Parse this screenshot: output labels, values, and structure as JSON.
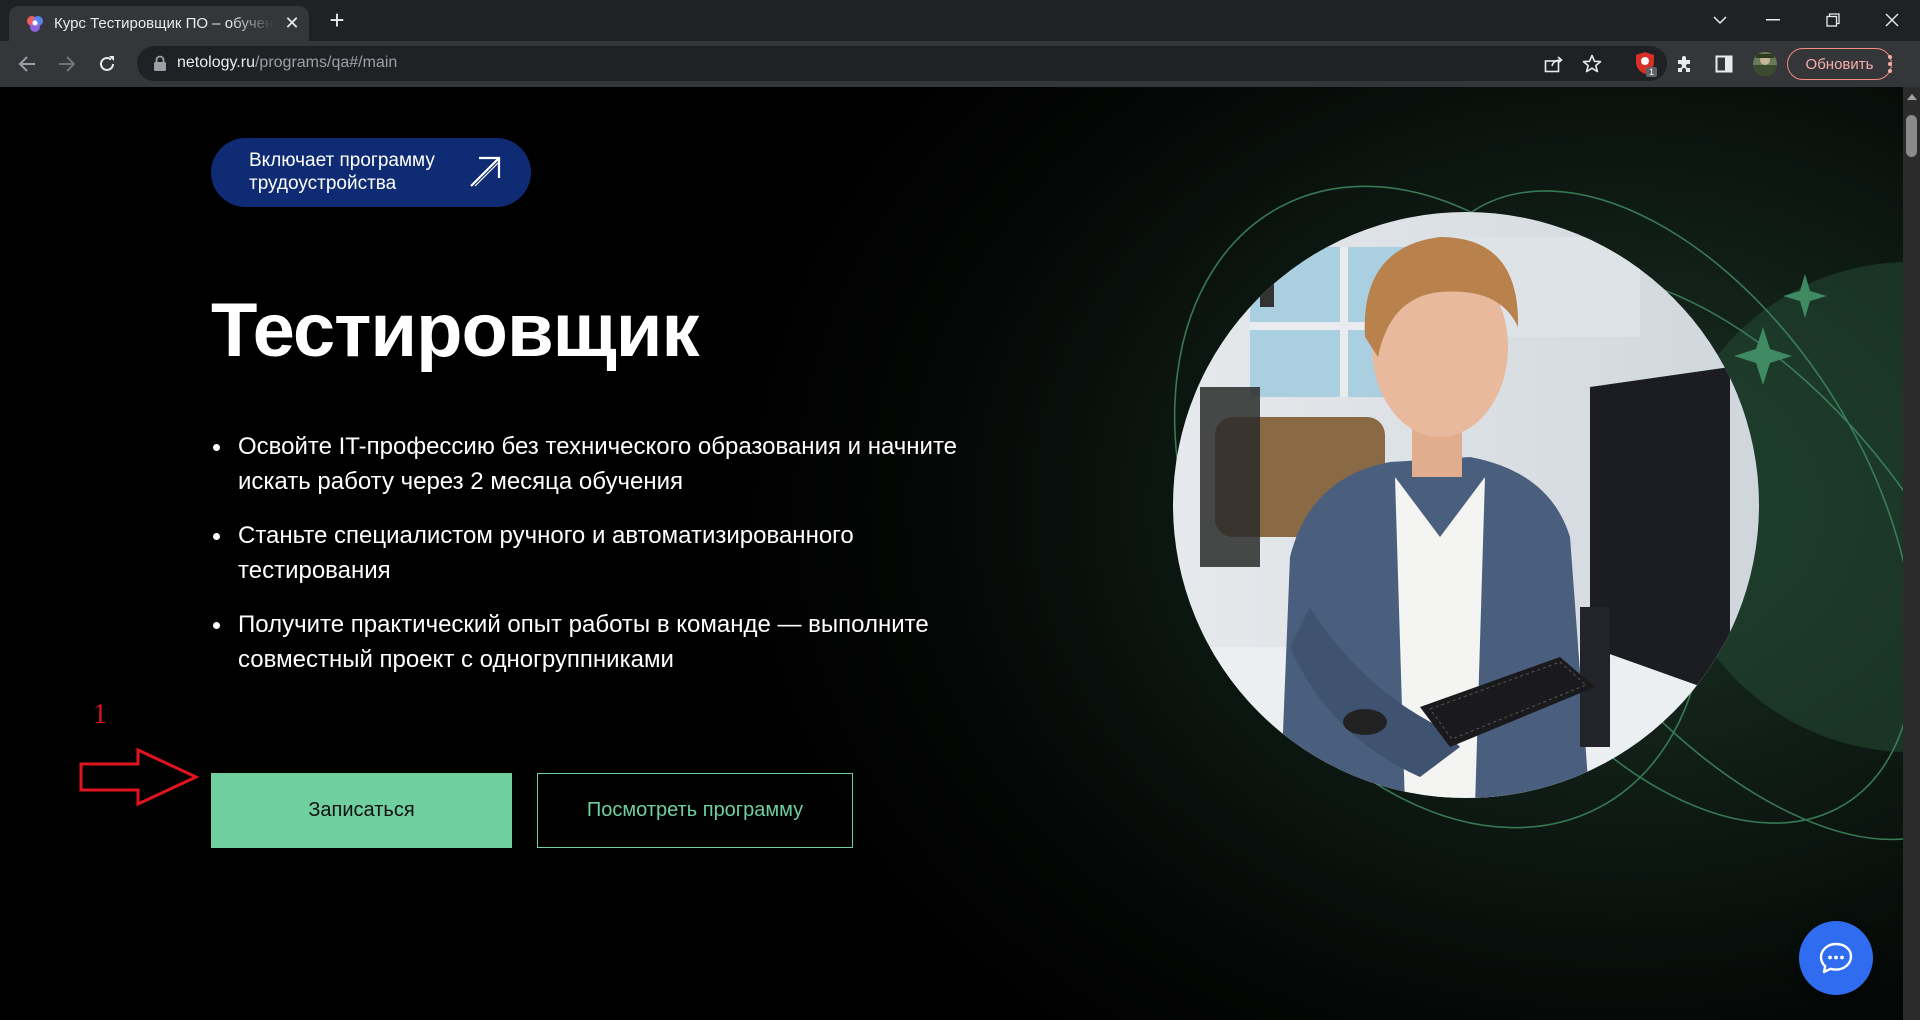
{
  "browser": {
    "tab_title": "Курс Тестировщик ПО – обучение",
    "url_host": "netology.ru",
    "url_path": "/programs/qa#/main",
    "update_label": "Обновить",
    "extension_badge": "1"
  },
  "hero": {
    "badge_text": "Включает программу трудоустройства",
    "title": "Тестировщик",
    "bullets": [
      "Освойте IT-профессию без технического образования и начните искать работу через 2 месяца обучения",
      "Станьте специалистом ручного и автоматизированного тестирования",
      "Получите практический опыт работы в команде — выполните совместный проект с одногруппниками"
    ],
    "primary_button": "Записаться",
    "secondary_button": "Посмотреть программу"
  },
  "annotation": {
    "number": "1",
    "color": "#e0141e"
  },
  "colors": {
    "accent_green": "#6fcf9f",
    "badge_blue": "#0f2b73",
    "chat_blue": "#2f6cf0"
  },
  "icons": [
    "back-icon",
    "forward-icon",
    "reload-icon",
    "lock-icon",
    "share-icon",
    "bookmark-star-icon",
    "extension-icon",
    "puzzle-icon",
    "sidepanel-icon",
    "profile-avatar",
    "menu-icon",
    "chat-icon"
  ]
}
